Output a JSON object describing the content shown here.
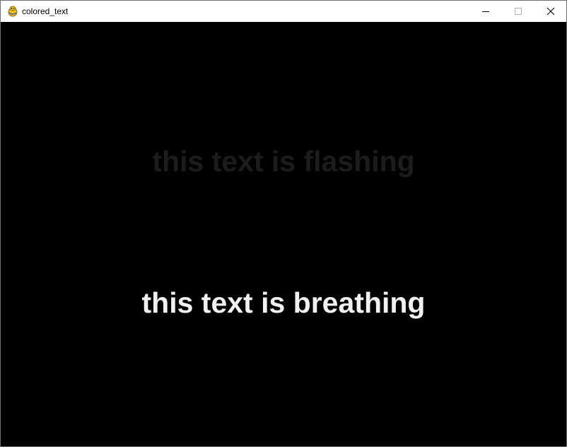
{
  "window": {
    "title": "colored_text",
    "icon": "pygame-snake-icon",
    "controls": {
      "minimize_icon": "minimize-icon",
      "maximize_icon": "maximize-icon",
      "close_icon": "close-icon"
    }
  },
  "canvas": {
    "background": "#000000",
    "texts": [
      {
        "text": "this text is flashing",
        "color": "#1c1c1c"
      },
      {
        "text": "this text is breathing",
        "color": "#f0f0f0"
      }
    ]
  }
}
